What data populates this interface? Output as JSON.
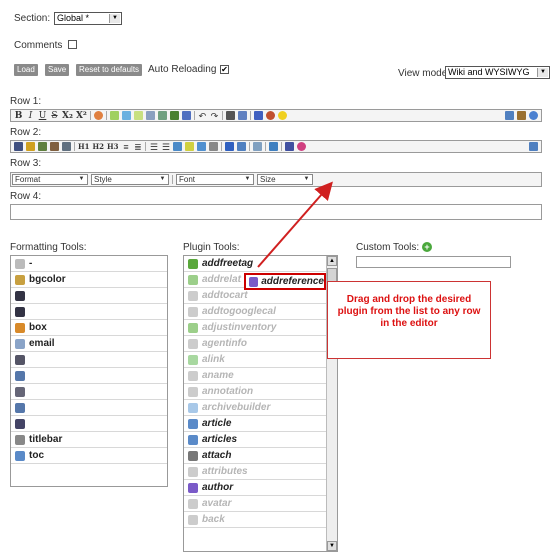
{
  "top": {
    "section_label": "Section:",
    "section_value": "Global *",
    "comments_label": "Comments",
    "load_label": "Load",
    "save_label": "Save",
    "reset_label": "Reset to defaults",
    "auto_reloading_label": "Auto Reloading",
    "auto_reloading_checked": "✔",
    "view_mode_label": "View mode",
    "view_mode_value": "Wiki and WYSIWYG"
  },
  "rows": {
    "row1_label": "Row 1:",
    "row2_label": "Row 2:",
    "row3_label": "Row 3:",
    "row4_label": "Row 4:",
    "row1_text": {
      "bold": "B",
      "italic": "I",
      "underline": "U",
      "strike": "S",
      "sub": "X₂",
      "sup": "X²"
    },
    "row2_text": {
      "h1": "H1",
      "h2": "H2",
      "h3": "H3"
    },
    "row3_selects": [
      "Format",
      "Style",
      "Font",
      "Size"
    ]
  },
  "formatting": {
    "label": "Formatting Tools:",
    "items": [
      {
        "text": "-",
        "icon": "separator-icon",
        "color": "#bbbbbb"
      },
      {
        "text": "bgcolor",
        "icon": "bgcolor-icon",
        "color": "#c8a040"
      },
      {
        "text": "",
        "icon": "ltr-icon",
        "color": "#334"
      },
      {
        "text": "",
        "icon": "rtl-icon",
        "color": "#334"
      },
      {
        "text": "box",
        "icon": "box-icon",
        "color": "#d88a2a"
      },
      {
        "text": "email",
        "icon": "email-icon",
        "color": "#8aa4c8"
      },
      {
        "text": "",
        "icon": "align-icon",
        "color": "#556"
      },
      {
        "text": "",
        "icon": "print-icon",
        "color": "#5577aa"
      },
      {
        "text": "",
        "icon": "list-icon",
        "color": "#667"
      },
      {
        "text": "",
        "icon": "table-icon",
        "color": "#5577aa"
      },
      {
        "text": "",
        "icon": "spellcheck-icon",
        "color": "#446"
      },
      {
        "text": "titlebar",
        "icon": "titlebar-icon",
        "color": "#888"
      },
      {
        "text": "toc",
        "icon": "toc-icon",
        "color": "#5a8ac8"
      }
    ]
  },
  "plugins": {
    "label": "Plugin Tools:",
    "items": [
      {
        "text": "addfreetag",
        "dim": false,
        "icon": "puzzle-icon",
        "color": "#5aa83c"
      },
      {
        "text": "addrelat",
        "dim": true,
        "icon": "puzzle-icon",
        "color": "#9ccf8a"
      },
      {
        "text": "addtocart",
        "dim": true,
        "icon": "cart-icon",
        "color": "#ccc"
      },
      {
        "text": "addtogooglecal",
        "dim": true,
        "icon": "calendar-icon",
        "color": "#ccc"
      },
      {
        "text": "adjustinventory",
        "dim": true,
        "icon": "puzzle-icon",
        "color": "#9ccf8a"
      },
      {
        "text": "agentinfo",
        "dim": true,
        "icon": "agent-icon",
        "color": "#ccc"
      },
      {
        "text": "alink",
        "dim": true,
        "icon": "link-icon",
        "color": "#a8d8a0"
      },
      {
        "text": "aname",
        "dim": true,
        "icon": "anchor-icon",
        "color": "#ccc"
      },
      {
        "text": "annotation",
        "dim": true,
        "icon": "annotation-icon",
        "color": "#ccc"
      },
      {
        "text": "archivebuilder",
        "dim": true,
        "icon": "archive-icon",
        "color": "#a8c8e8"
      },
      {
        "text": "article",
        "dim": false,
        "icon": "article-icon",
        "color": "#5a8ac8"
      },
      {
        "text": "articles",
        "dim": false,
        "icon": "articles-icon",
        "color": "#5a8ac8"
      },
      {
        "text": "attach",
        "dim": false,
        "icon": "paperclip-icon",
        "color": "#777"
      },
      {
        "text": "attributes",
        "dim": true,
        "icon": "attributes-icon",
        "color": "#ccc"
      },
      {
        "text": "author",
        "dim": false,
        "icon": "author-icon",
        "color": "#7a5ac8"
      },
      {
        "text": "avatar",
        "dim": true,
        "icon": "avatar-icon",
        "color": "#ccc"
      },
      {
        "text": "back",
        "dim": true,
        "icon": "back-icon",
        "color": "#ccc"
      }
    ]
  },
  "custom": {
    "label": "Custom Tools:"
  },
  "drag": {
    "text": "addreference"
  },
  "callout": {
    "text": "Drag and drop the desired plugin from the list to any row in the editor"
  }
}
